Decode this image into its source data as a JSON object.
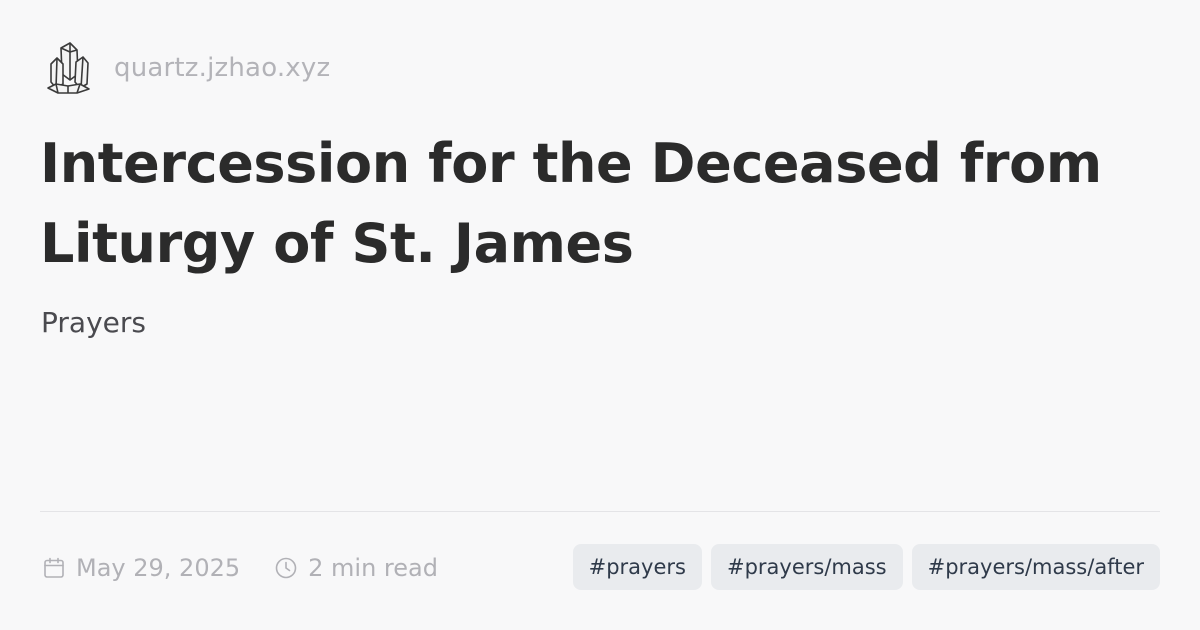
{
  "site": {
    "name": "quartz.jzhao.xyz",
    "logo_icon": "quartz-crystal-icon"
  },
  "title": "Intercession for the Deceased from Liturgy of St. James",
  "description": "Prayers",
  "meta": {
    "date_icon": "calendar-icon",
    "date": "May 29, 2025",
    "reading_time_icon": "clock-icon",
    "reading_time": "2 min read"
  },
  "tags": [
    "#prayers",
    "#prayers/mass",
    "#prayers/mass/after"
  ],
  "colors": {
    "background": "#f8f8f9",
    "title": "#2b2b2b",
    "muted_text": "#b1b1b6",
    "tag_background": "#e9ebee",
    "tag_text": "#2f3a4a"
  }
}
